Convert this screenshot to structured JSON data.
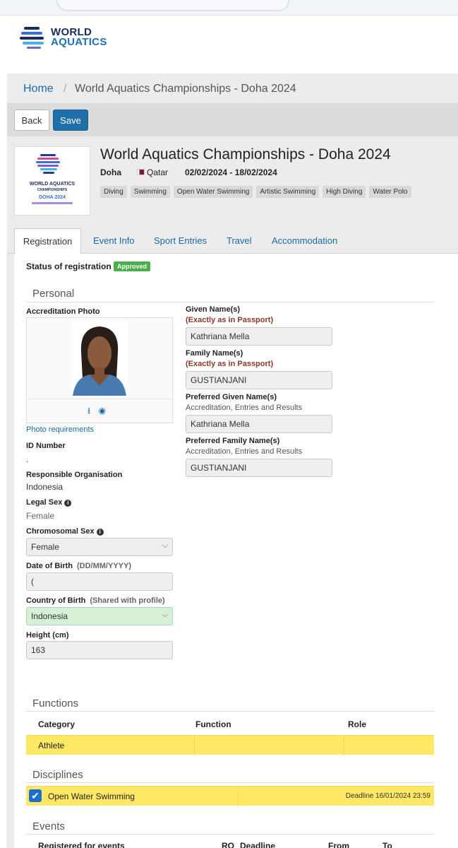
{
  "logo": {
    "line1": "WORLD",
    "line2": "AQUATICS"
  },
  "breadcrumb": {
    "home": "Home",
    "separator": "/",
    "current": "World Aquatics Championships - Doha 2024"
  },
  "toolbar": {
    "back_label": "Back",
    "save_label": "Save"
  },
  "event": {
    "title": "World Aquatics Championships - Doha 2024",
    "city": "Doha",
    "country": "Qatar",
    "dates": "02/02/2024  -  18/02/2024",
    "logo": {
      "line1": "WORLD AQUATICS",
      "line2": "CHAMPIONSHIPS",
      "line3": "DOHA 2024"
    },
    "tags": [
      "Diving",
      "Swimming",
      "Open Water Swimming",
      "Artistic Swimming",
      "High Diving",
      "Water Polo"
    ]
  },
  "tabs": [
    "Registration",
    "Event Info",
    "Sport Entries",
    "Travel",
    "Accommodation"
  ],
  "registration": {
    "status_label": "Status of registration",
    "status_value": "Approved"
  },
  "personal": {
    "section_title": "Personal",
    "photo_label": "Accreditation Photo",
    "photo_requirements": "Photo requirements",
    "id_number_label": "ID Number",
    "id_number_value": ".",
    "org_label": "Responsible Organisation",
    "org_value": "Indonesia",
    "legal_sex_label": "Legal Sex",
    "legal_sex_value": "Female",
    "chromosomal_sex_label": "Chromosomal Sex",
    "chromosomal_sex_value": "Female",
    "dob_label": "Date of Birth",
    "dob_hint": "(DD/MM/YYYY)",
    "dob_value": "(",
    "country_birth_label": "Country of Birth",
    "country_birth_hint": "(Shared with profile)",
    "country_birth_value": "Indonesia",
    "height_label": "Height (cm)",
    "height_value": "163",
    "given_name_label": "Given Name(s)",
    "given_name_note": "(Exactly as in Passport)",
    "given_name_value": "Kathriana Mella",
    "family_name_label": "Family Name(s)",
    "family_name_note": "(Exactly as in Passport)",
    "family_name_value": "GUSTIANJANI",
    "pref_given_label": "Preferred Given Name(s)",
    "pref_given_note": "Accreditation, Entries and Results",
    "pref_given_value": "Kathriana Mella",
    "pref_family_label": "Preferred Family Name(s)",
    "pref_family_note": "Accreditation, Entries and Results",
    "pref_family_value": "GUSTIANJANI"
  },
  "functions": {
    "section_title": "Functions",
    "headers": {
      "category": "Category",
      "function": "Function",
      "role": "Role"
    },
    "rows": [
      {
        "category": "Athlete",
        "function": "",
        "role": ""
      }
    ]
  },
  "disciplines": {
    "section_title": "Disciplines",
    "rows": [
      {
        "name": "Open Water Swimming",
        "checked": true,
        "deadline": "Deadline 16/01/2024 23:59"
      }
    ]
  },
  "events": {
    "section_title": "Events",
    "headers": {
      "registered": "Registered for events",
      "ro": "RO",
      "deadline": "Deadline",
      "from": "From",
      "to": "To"
    }
  }
}
